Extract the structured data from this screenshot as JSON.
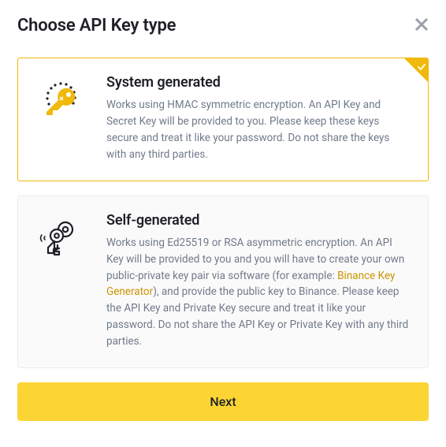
{
  "modal": {
    "title": "Choose API Key type",
    "options": [
      {
        "title": "System generated",
        "description": "Works using HMAC symmetric encryption. An API Key and Secret Key will be provided to you. Please keep these keys secure and treat it like your password. Do not share the keys with any third parties."
      },
      {
        "title": "Self-generated",
        "desc_before_link": "Works using Ed25519 or RSA asymmetric encryption. An API Key will be provided to you and you will have to create your own public-private key pair via software (for example: ",
        "link_text": "Binance Key Generator",
        "desc_after_link": "), and provide the public key to Binance. Please keep the API Key and Private Key secure and treat it like your password. Do not share the API Key or Private Key with any third parties."
      }
    ],
    "next_label": "Next"
  }
}
